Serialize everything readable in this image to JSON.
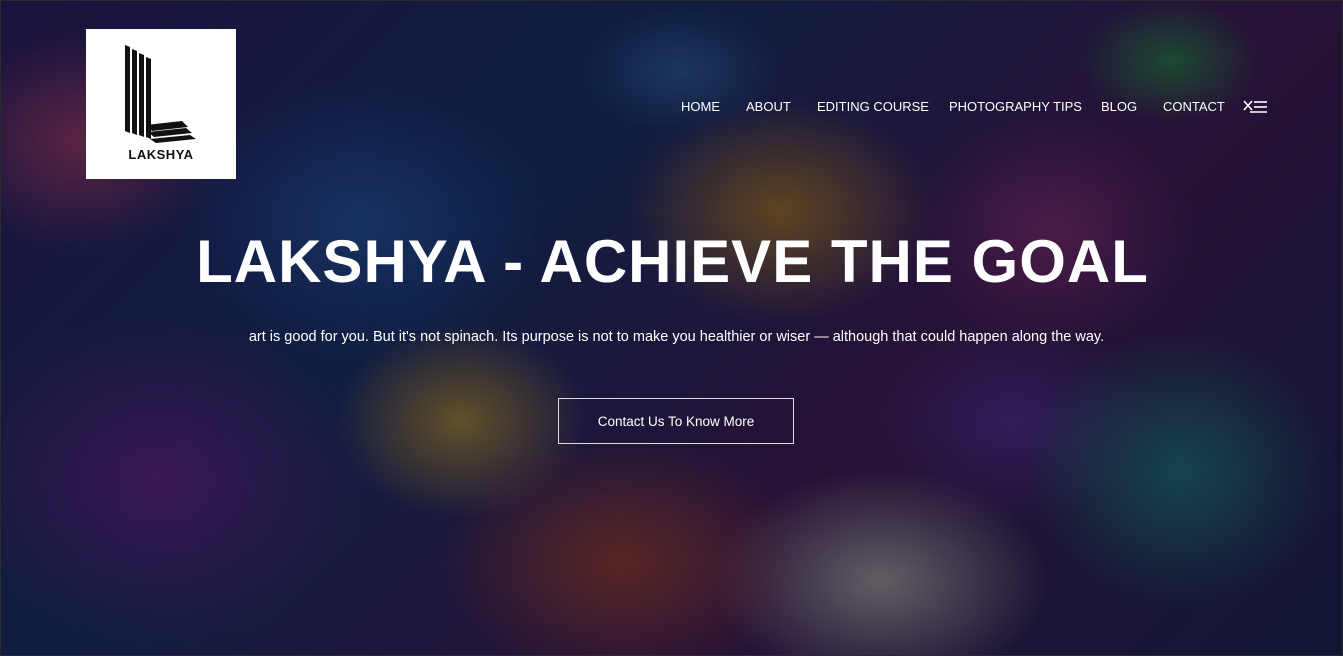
{
  "logo": {
    "text": "LAKSHYA",
    "icon": "lakshya-l-logo"
  },
  "nav": {
    "items": [
      {
        "label": "HOME"
      },
      {
        "label": "ABOUT"
      },
      {
        "label": "EDITING COURSE"
      },
      {
        "label": "PHOTOGRAPHY TIPS"
      },
      {
        "label": "BLOG"
      },
      {
        "label": "CONTACT"
      }
    ],
    "menu_icon": "hamburger-menu-icon"
  },
  "hero": {
    "title": "LAKSHYA - ACHIEVE THE GOAL",
    "subtitle": "art is good for you. But it's not spinach. Its purpose is not to make you healthier or wiser — although that could happen along the way.",
    "cta_label": "Contact Us To Know More",
    "background": "colorful-lion-illustration"
  },
  "colors": {
    "overlay": "#080a1e",
    "text": "#ffffff",
    "logo_bg": "#ffffff"
  }
}
